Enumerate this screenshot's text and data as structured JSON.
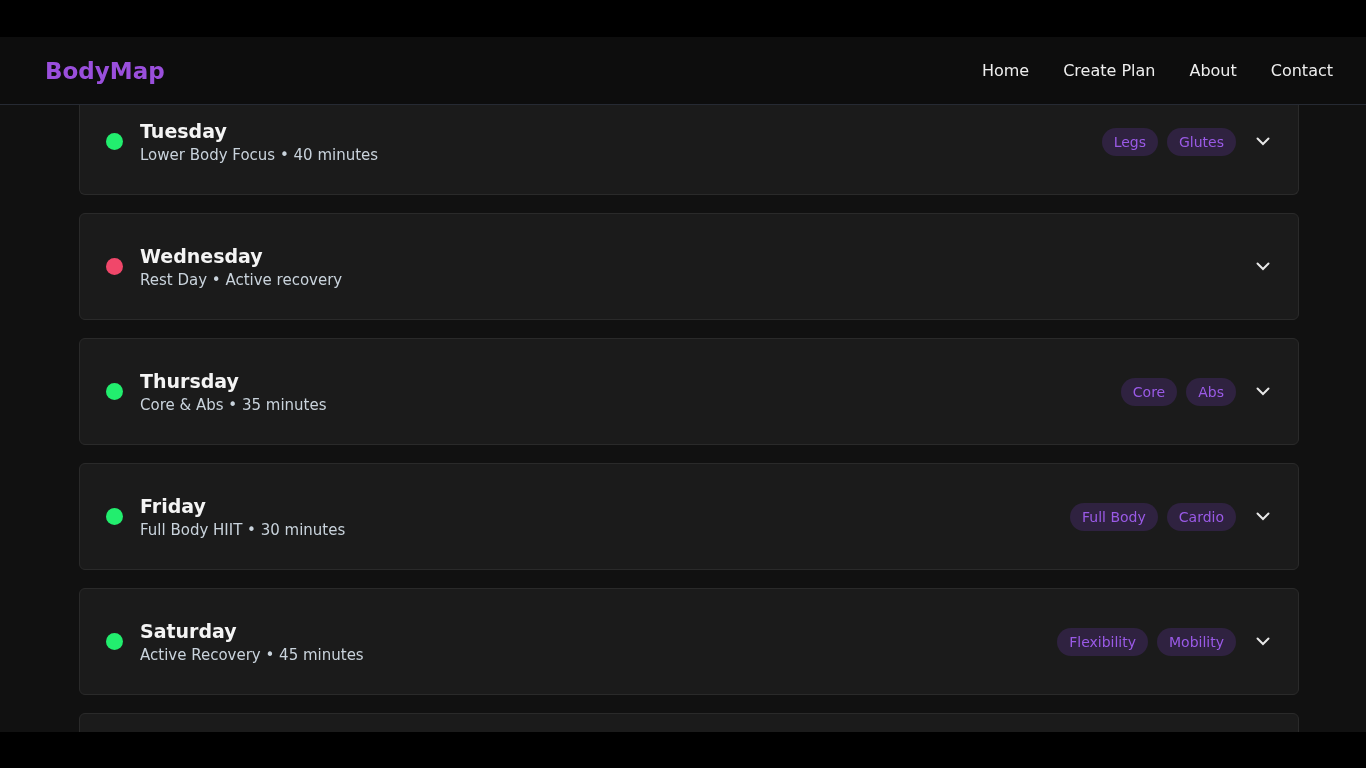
{
  "brand": "BodyMap",
  "nav": [
    "Home",
    "Create Plan",
    "About",
    "Contact"
  ],
  "days": [
    {
      "day": "Tuesday",
      "summary": "Lower Body Focus • 40 minutes",
      "color": "#22ee6e",
      "tags": [
        "Legs",
        "Glutes"
      ]
    },
    {
      "day": "Wednesday",
      "summary": "Rest Day • Active recovery",
      "color": "#f0476a"
    },
    {
      "day": "Thursday",
      "summary": "Core & Abs • 35 minutes",
      "color": "#22ee6e",
      "tags": [
        "Core",
        "Abs"
      ]
    },
    {
      "day": "Friday",
      "summary": "Full Body HIIT • 30 minutes",
      "color": "#22ee6e",
      "tags": [
        "Full Body",
        "Cardio"
      ]
    },
    {
      "day": "Saturday",
      "summary": "Active Recovery • 45 minutes",
      "color": "#22ee6e",
      "tags": [
        "Flexibility",
        "Mobility"
      ]
    }
  ]
}
